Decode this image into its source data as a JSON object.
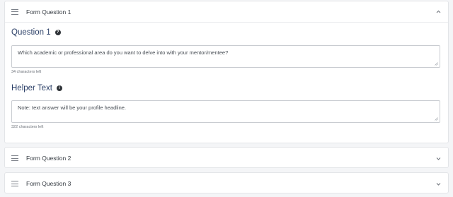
{
  "panels": [
    {
      "title": "Form Question 1",
      "expanded": true,
      "question_label": "Question 1",
      "question_icon": "question-circle-icon",
      "question_value": "Which academic or professional area do you want to delve into with your mentor/mentee?",
      "question_count": "34 characters left",
      "helper_label": "Helper Text",
      "helper_icon": "info-circle-icon",
      "helper_value": "Note: text answer will be your profile headline.",
      "helper_count": "322 characters left"
    },
    {
      "title": "Form Question 2",
      "expanded": false
    },
    {
      "title": "Form Question 3",
      "expanded": false
    }
  ],
  "colors": {
    "label": "#2b3f67",
    "border": "#c9ccd1",
    "background": "#f4f5f7"
  }
}
